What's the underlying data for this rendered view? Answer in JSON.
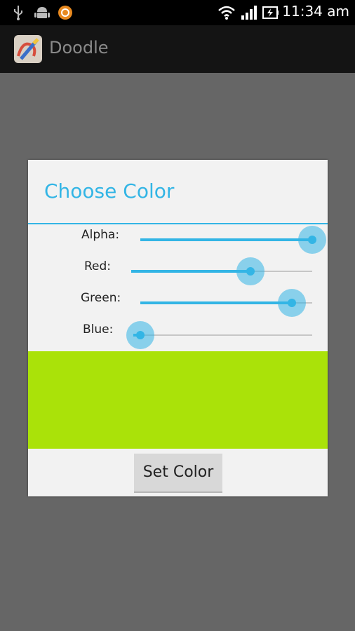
{
  "status_bar": {
    "time": "11:34 am",
    "icons": [
      "usb-icon",
      "android-debug-icon",
      "notification-app-icon",
      "wifi-icon",
      "signal-icon",
      "battery-charging-icon"
    ]
  },
  "action_bar": {
    "app_title": "Doodle",
    "app_icon": "doodle-app-icon"
  },
  "dialog": {
    "title": "Choose Color",
    "accent_color": "#33b5e5",
    "sliders": [
      {
        "label": "Alpha:",
        "value_fraction": 1.0
      },
      {
        "label": "Red:",
        "value_fraction": 0.66
      },
      {
        "label": "Green:",
        "value_fraction": 0.88
      },
      {
        "label": "Blue:",
        "value_fraction": 0.04
      }
    ],
    "preview_color": "#aae209",
    "set_color_label": "Set Color"
  }
}
